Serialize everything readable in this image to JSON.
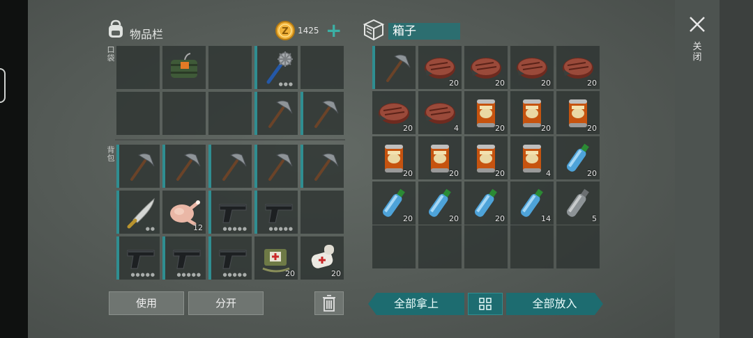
{
  "inventory": {
    "title": "物品栏",
    "coins": "1425",
    "pocket_label": "口袋",
    "backpack_label": "背包",
    "slots": [
      {
        "item": "",
        "qty": "",
        "dur": ""
      },
      {
        "item": "bomb",
        "qty": "",
        "dur": ""
      },
      {
        "item": "",
        "qty": "",
        "dur": ""
      },
      {
        "item": "mace",
        "qty": "",
        "dur": "●●●"
      },
      {
        "item": "",
        "qty": "",
        "dur": ""
      },
      {
        "item": "",
        "qty": "",
        "dur": ""
      },
      {
        "item": "",
        "qty": "",
        "dur": ""
      },
      {
        "item": "",
        "qty": "",
        "dur": ""
      },
      {
        "item": "pickaxe",
        "qty": "",
        "dur": ""
      },
      {
        "item": "pickaxe",
        "qty": "",
        "dur": ""
      },
      {
        "item": "pickaxe",
        "qty": "",
        "dur": ""
      },
      {
        "item": "pickaxe",
        "qty": "",
        "dur": ""
      },
      {
        "item": "pickaxe",
        "qty": "",
        "dur": ""
      },
      {
        "item": "pickaxe",
        "qty": "",
        "dur": ""
      },
      {
        "item": "pickaxe",
        "qty": "",
        "dur": ""
      },
      {
        "item": "machete",
        "qty": "",
        "dur": "●●"
      },
      {
        "item": "chicken",
        "qty": "12",
        "dur": ""
      },
      {
        "item": "pistol",
        "qty": "",
        "dur": "●●●●●"
      },
      {
        "item": "pistol",
        "qty": "",
        "dur": "●●●●●"
      },
      {
        "item": "",
        "qty": "",
        "dur": ""
      },
      {
        "item": "pistol",
        "qty": "",
        "dur": "●●●●●"
      },
      {
        "item": "pistol",
        "qty": "",
        "dur": "●●●●●"
      },
      {
        "item": "pistol",
        "qty": "",
        "dur": "●●●●●"
      },
      {
        "item": "medkit",
        "qty": "20",
        "dur": ""
      },
      {
        "item": "bandage",
        "qty": "20",
        "dur": ""
      }
    ],
    "use_label": "使用",
    "split_label": "分开"
  },
  "box": {
    "title": "箱子",
    "slots": [
      {
        "item": "pickaxe",
        "qty": ""
      },
      {
        "item": "steak",
        "qty": "20"
      },
      {
        "item": "steak",
        "qty": "20"
      },
      {
        "item": "steak",
        "qty": "20"
      },
      {
        "item": "steak",
        "qty": "20"
      },
      {
        "item": "steak",
        "qty": "20"
      },
      {
        "item": "steak",
        "qty": "4"
      },
      {
        "item": "can",
        "qty": "20"
      },
      {
        "item": "can",
        "qty": "20"
      },
      {
        "item": "can",
        "qty": "20"
      },
      {
        "item": "can",
        "qty": "20"
      },
      {
        "item": "can",
        "qty": "20"
      },
      {
        "item": "can",
        "qty": "20"
      },
      {
        "item": "can",
        "qty": "4"
      },
      {
        "item": "bottle",
        "qty": "20"
      },
      {
        "item": "bottle",
        "qty": "20"
      },
      {
        "item": "bottle",
        "qty": "20"
      },
      {
        "item": "bottle",
        "qty": "20"
      },
      {
        "item": "bottle",
        "qty": "14"
      },
      {
        "item": "bottle_empty",
        "qty": "5"
      },
      {
        "item": "",
        "qty": ""
      },
      {
        "item": "",
        "qty": ""
      },
      {
        "item": "",
        "qty": ""
      },
      {
        "item": "",
        "qty": ""
      },
      {
        "item": "",
        "qty": ""
      }
    ],
    "take_all_label": "全部拿上",
    "put_all_label": "全部放入"
  },
  "close_label": "关闭",
  "colors": {
    "accent": "#2f8e91",
    "button_teal": "#1d6c70",
    "plus": "#3bb0a5",
    "coin": "#f0b23a"
  }
}
